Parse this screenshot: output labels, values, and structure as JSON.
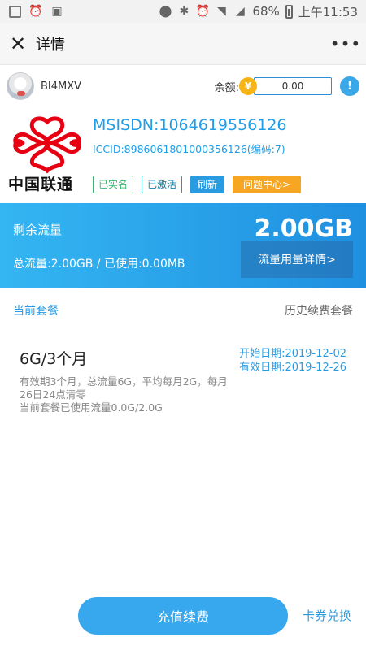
{
  "status_bar": {
    "battery": "68%",
    "time": "上午11:53",
    "left_icons": [
      "message-icon",
      "alarm-icon",
      "image-icon"
    ],
    "right_icons": [
      "location-icon",
      "bluetooth-icon",
      "alarm-icon",
      "wifi-icon",
      "signal-icon",
      "battery-icon"
    ]
  },
  "header": {
    "close_glyph": "✕",
    "title": "详情",
    "more_glyph": "•••"
  },
  "user": {
    "name": "BI4MXV",
    "balance_label": "余额:",
    "balance_value": "0.00",
    "coin_glyph": "¥",
    "info_glyph": "!"
  },
  "carrier": {
    "logo_text": "中国联通",
    "msisdn": "MSISDN:1064619556126",
    "iccid": "ICCID:8986061801000356126(编码:7)",
    "tags": {
      "realname": "已实名",
      "activated": "已激活",
      "refresh": "刷新",
      "help": "问题中心>"
    }
  },
  "traffic": {
    "remaining_label": "剩余流量",
    "remaining_value": "2.00GB",
    "total_used": "总流量:2.00GB / 已使用:0.00MB",
    "detail_button": "流量用量详情>"
  },
  "plan_tabs": {
    "current": "当前套餐",
    "history": "历史续费套餐"
  },
  "plan": {
    "name": "6G/3个月",
    "start_date": "开始日期:2019-12-02",
    "valid_date": "有效日期:2019-12-26",
    "description": "有效期3个月，总流量6G，平均每月2G，每月26日24点清零",
    "usage": "当前套餐已使用流量0.0G/2.0G"
  },
  "footer": {
    "recharge_button": "充值续费",
    "redeem_link": "卡券兑换"
  },
  "colors": {
    "accent": "#2a9be0",
    "banner_start": "#34b6f2",
    "banner_end": "#1f8fe0",
    "orange": "#f6a623",
    "logo_red": "#e60012"
  }
}
